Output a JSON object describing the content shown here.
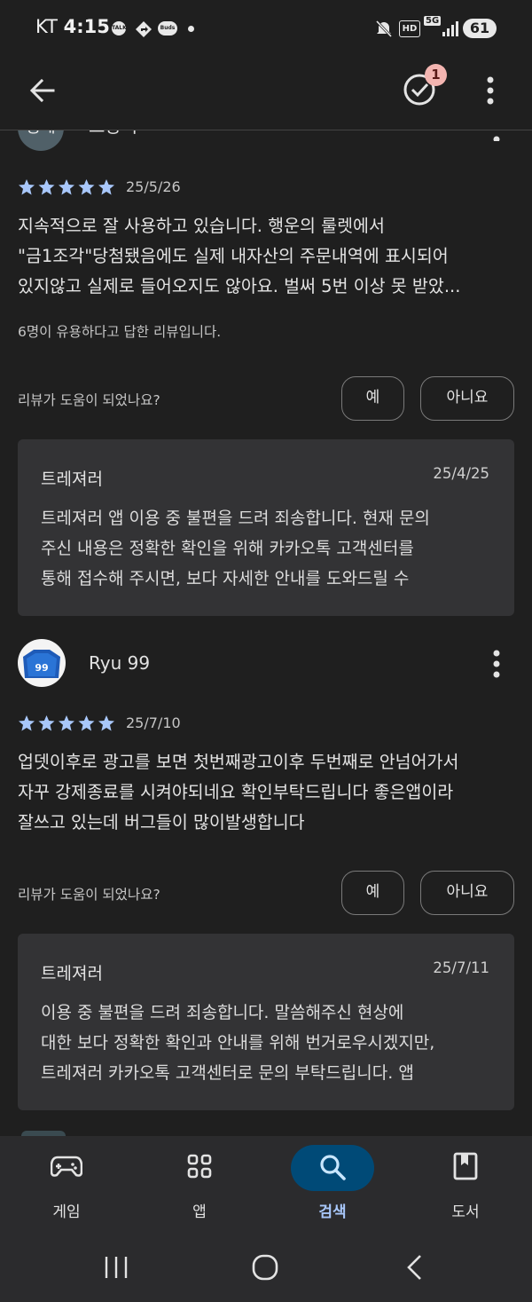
{
  "status_bar": {
    "carrier": "KT",
    "time": "4:15",
    "icons": [
      "talk-icon",
      "navigation-icon",
      "buds-icon",
      "notification-dot"
    ],
    "talk_label": "TALK",
    "buds_label": "Buds",
    "right_icons": [
      "mute-icon",
      "hd-icon",
      "5g-icon",
      "signal-icon"
    ],
    "battery": "61"
  },
  "app_bar": {
    "back_icon": "arrow-left-icon",
    "badge_count": "1",
    "check_icon": "check-circle-icon",
    "more_icon": "more-vert-icon"
  },
  "reviews": [
    {
      "avatar_text": "동네",
      "user_name": "고양이",
      "rating": 5,
      "date": "25/5/26",
      "text_lines": [
        "지속적으로 잘 사용하고 있습니다. 행운의 룰렛에서",
        "\"금1조각\"당첨됐음에도 실제 내자산의 주문내역에 표시되어",
        "있지않고 실제로 들어오지도 않아요. 벌써 5번 이상 못 받았..."
      ],
      "helpful_count_text": "6명이 유용하다고 답한 리뷰입니다.",
      "helpful_question": "리뷰가 도움이 되었나요?",
      "yes_label": "예",
      "no_label": "아니요",
      "reply": {
        "developer": "트레져러",
        "date": "25/4/25",
        "text_lines": [
          "트레져러 앱 이용 중 불편을 드려 죄송합니다. 현재 문의",
          "주신 내용은 정확한 확인을 위해 카카오톡 고객센터를",
          "통해 접수해 주시면, 보다 자세한 안내를 도와드릴 수"
        ]
      }
    },
    {
      "avatar_text": "99",
      "user_name": "Ryu 99",
      "rating": 5,
      "date": "25/7/10",
      "text_lines": [
        "업뎃이후로 광고를 보면 첫번째광고이후 두번째로 안넘어가서",
        "자꾸 강제종료를 시켜야되네요 확인부탁드립니다 좋은앱이라",
        "잘쓰고 있는데 버그들이 많이발생합니다"
      ],
      "helpful_question": "리뷰가 도움이 되었나요?",
      "yes_label": "예",
      "no_label": "아니요",
      "reply": {
        "developer": "트레져러",
        "date": "25/7/11",
        "text_lines": [
          "이용 중 불편을 드려 죄송합니다. 말씀해주신 현상에",
          "대한 보다 정확한 확인과 안내를 위해 번거로우시겠지만,",
          "트레져러 카카오톡 고객센터로 문의 부탁드립니다. 앱"
        ]
      }
    }
  ],
  "bottom_nav": {
    "items": [
      {
        "label": "게임",
        "icon": "gamepad-icon",
        "active": false
      },
      {
        "label": "앱",
        "icon": "apps-grid-icon",
        "active": false
      },
      {
        "label": "검색",
        "icon": "search-icon",
        "active": true
      },
      {
        "label": "도서",
        "icon": "book-icon",
        "active": false
      }
    ]
  },
  "system_nav": {
    "icons": [
      "recents-icon",
      "home-icon",
      "back-icon"
    ]
  },
  "colors": {
    "background": "#1f1f1f",
    "reply_card": "#333335",
    "star": "#a8c7fa",
    "active_nav": "#004a77",
    "active_label": "#a8c7fa",
    "badge": "#f3b5b1"
  }
}
